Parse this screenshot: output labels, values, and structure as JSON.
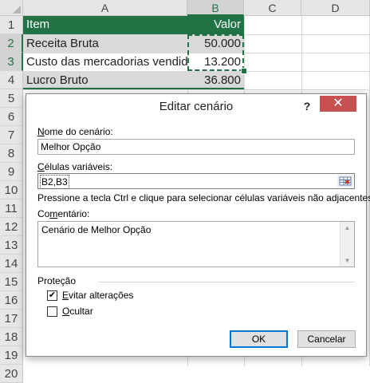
{
  "sheet": {
    "columns": [
      "A",
      "B",
      "C",
      "D"
    ],
    "rows": [
      "1",
      "2",
      "3",
      "4",
      "5",
      "6",
      "7",
      "8",
      "9",
      "10",
      "11",
      "12",
      "13",
      "14",
      "15",
      "16",
      "17",
      "18",
      "19",
      "20"
    ],
    "header_fill_color": "#217346",
    "total_fill_color": "#d9d9d9",
    "cells": {
      "A1": "Item",
      "B1": "Valor",
      "A2": "Receita Bruta",
      "B2": "50.000",
      "A3": "Custo das mercadorias vendidas",
      "B3": "13.200",
      "A4": "Lucro Bruto",
      "B4": "36.800"
    }
  },
  "dialog": {
    "title": "Editar cenário",
    "help": "?",
    "close_icon": "close-icon",
    "close": "✕",
    "name_label": "Nome do cenário:",
    "name_value": "Melhor Opção",
    "cells_label": "Células variáveis:",
    "cells_value": "B2,B3",
    "hint": "Pressione a tecla Ctrl e clique para selecionar células variáveis não adjacentes.",
    "comment_label": "Comentário:",
    "comment_value": "Cenário de Melhor Opção",
    "protection_label": "Proteção",
    "prevent_changes_label": "Evitar alterações",
    "prevent_changes_checked": true,
    "hide_label": "Ocultar",
    "hide_checked": false,
    "ok": "OK",
    "cancel": "Cancelar"
  }
}
